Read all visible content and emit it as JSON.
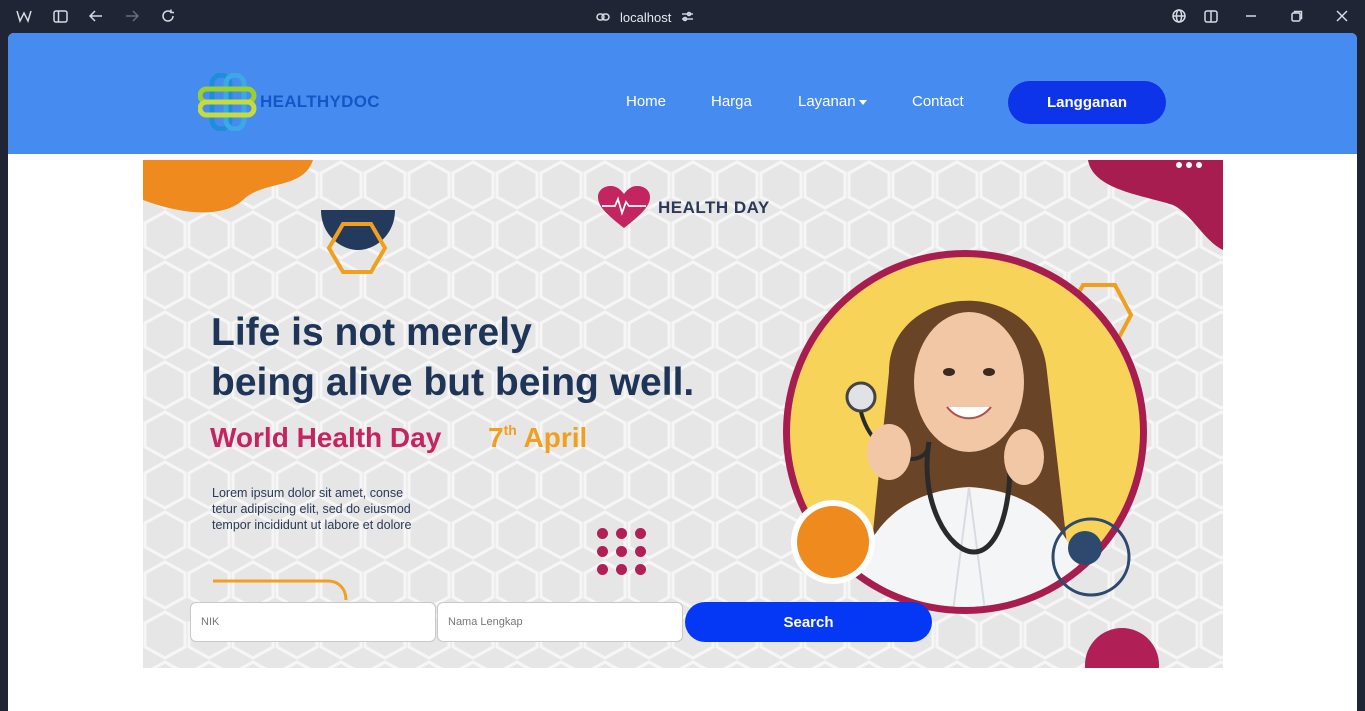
{
  "browser": {
    "url": "localhost"
  },
  "brand": {
    "name": "HEALTHYDOC"
  },
  "nav": {
    "items": [
      {
        "label": "Home"
      },
      {
        "label": "Harga"
      },
      {
        "label": "Layanan"
      },
      {
        "label": "Contact"
      }
    ],
    "subscribe_label": "Langganan"
  },
  "banner": {
    "logo_text": "HEALTH DAY",
    "headline_line1": "Life is not merely",
    "headline_line2": "being alive but being well.",
    "event_name": "World Health Day",
    "event_date_num": "7",
    "event_date_sup": "th",
    "event_date_month": "April",
    "lorem_line1": "Lorem ipsum dolor sit amet, conse",
    "lorem_line2": "tetur adipiscing elit, sed do eiusmod",
    "lorem_line3": "tempor incididunt ut labore et dolore"
  },
  "search": {
    "nik_placeholder": "NIK",
    "name_placeholder": "Nama Lengkap",
    "button_label": "Search"
  },
  "colors": {
    "navbar": "#468cf0",
    "primary_button": "#0d34e8",
    "headline": "#1e3557",
    "accent_pink": "#c4245f",
    "accent_orange": "#f0a020"
  }
}
